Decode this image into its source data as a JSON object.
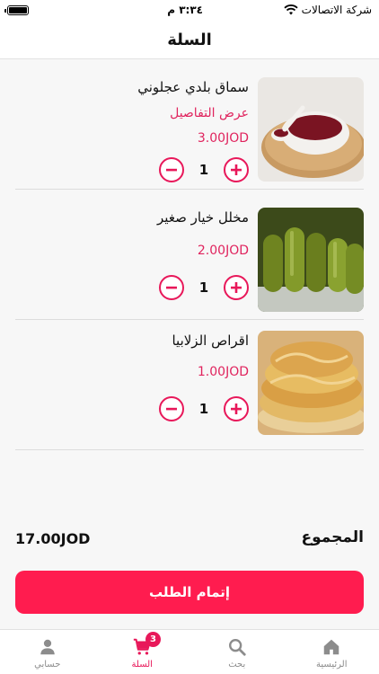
{
  "status_bar": {
    "carrier": "شركة الاتصالات",
    "time": "٣:٣٤ م"
  },
  "header": {
    "title": "السلة"
  },
  "items": [
    {
      "name": "سماق بلدي عجلوني",
      "details_link": "عرض التفاصيل",
      "price": "3.00JOD",
      "quantity": "1",
      "image": "sumac-in-bowl-image"
    },
    {
      "name": "مخلل خيار صغير",
      "details_link": "",
      "price": "2.00JOD",
      "quantity": "1",
      "image": "pickled-cucumbers-image"
    },
    {
      "name": "اقراص الزلابيا",
      "details_link": "",
      "price": "1.00JOD",
      "quantity": "1",
      "image": "zalabia-pastry-image"
    }
  ],
  "total": {
    "label": "المجموع",
    "value": "17.00JOD"
  },
  "checkout_button": "إتمام الطلب",
  "tabbar": {
    "tabs": [
      {
        "label": "الرئيسية",
        "icon": "home-icon",
        "active": false
      },
      {
        "label": "بحث",
        "icon": "search-icon",
        "active": false
      },
      {
        "label": "السلة",
        "icon": "cart-icon",
        "active": true,
        "badge": "3"
      },
      {
        "label": "حسابي",
        "icon": "user-icon",
        "active": false
      }
    ]
  },
  "colors": {
    "accent": "#e8185a",
    "checkout": "#ff1c4f",
    "inactive_tab": "#8c8c8c"
  }
}
